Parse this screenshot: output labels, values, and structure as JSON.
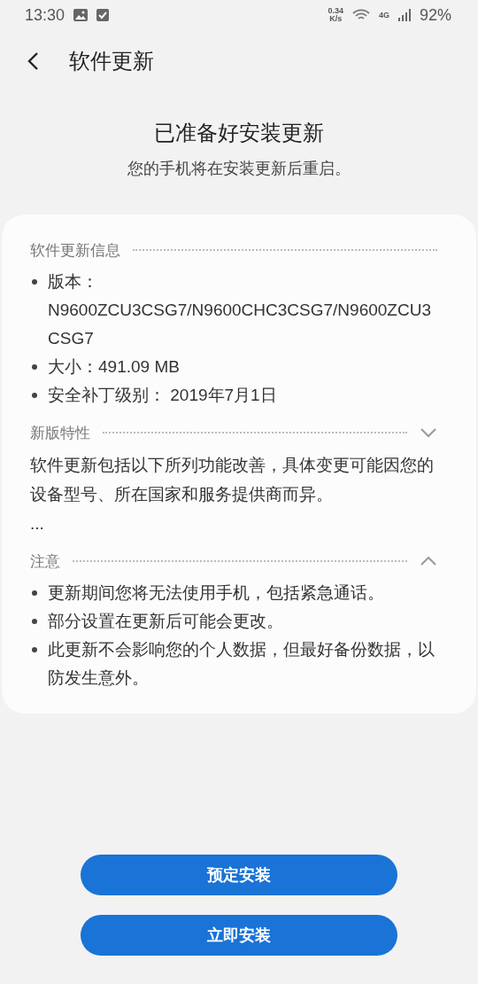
{
  "status_bar": {
    "time": "13:30",
    "net_speed": "0.34",
    "net_unit": "K/s",
    "network": "4G",
    "battery": "92%"
  },
  "header": {
    "title": "软件更新"
  },
  "hero": {
    "title": "已准备好安装更新",
    "subtitle": "您的手机将在安装更新后重启。"
  },
  "sections": [
    {
      "kind": "list",
      "title": "软件更新信息",
      "items": [
        "版本：N9600ZCU3CSG7/N9600CHC3CSG7/N9600ZCU3CSG7",
        "大小：491.09 MB",
        "安全补丁级别： 2019年7月1日"
      ]
    },
    {
      "kind": "text",
      "title": "新版特性",
      "expanded": false,
      "text": "软件更新包括以下所列功能改善，具体变更可能因您的设备型号、所在国家和服务提供商而异。",
      "more": "..."
    },
    {
      "kind": "list",
      "title": "注意",
      "expanded": true,
      "items": [
        "更新期间您将无法使用手机，包括紧急通话。",
        "部分设置在更新后可能会更改。",
        "此更新不会影响您的个人数据，但最好备份数据，以防发生意外。"
      ]
    }
  ],
  "buttons": [
    "预定安装",
    "立即安装"
  ]
}
